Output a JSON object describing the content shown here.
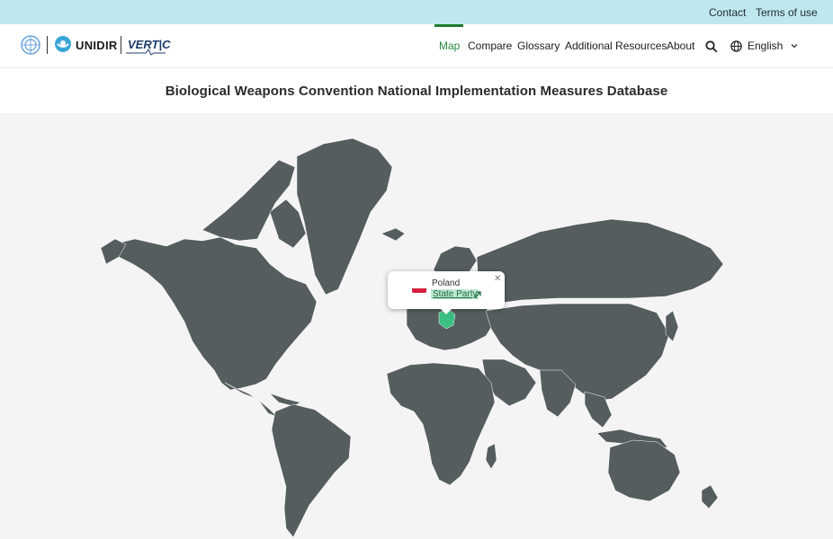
{
  "topbar": {
    "contact": "Contact",
    "terms": "Terms of use"
  },
  "header": {
    "unidir": "UNIDIR",
    "vertic": "VERT|C",
    "nav": {
      "map": "Map",
      "compare": "Compare",
      "glossary": "Glossary",
      "resources": "Additional Resources",
      "about": "About"
    },
    "language": "English"
  },
  "page": {
    "title": "Biological Weapons Convention National Implementation Measures Database"
  },
  "popup": {
    "country": "Poland",
    "status": "State Party"
  },
  "colors": {
    "topbar": "#bfe8ee",
    "land": "#555d5f",
    "highlight": "#3cbf83",
    "active_nav": "#2a8a3e"
  },
  "icons": [
    "un-emblem-icon",
    "unidir-logo-icon",
    "search-icon",
    "globe-icon",
    "chevron-down-icon",
    "close-icon",
    "external-arrow-icon",
    "poland-flag-icon"
  ]
}
